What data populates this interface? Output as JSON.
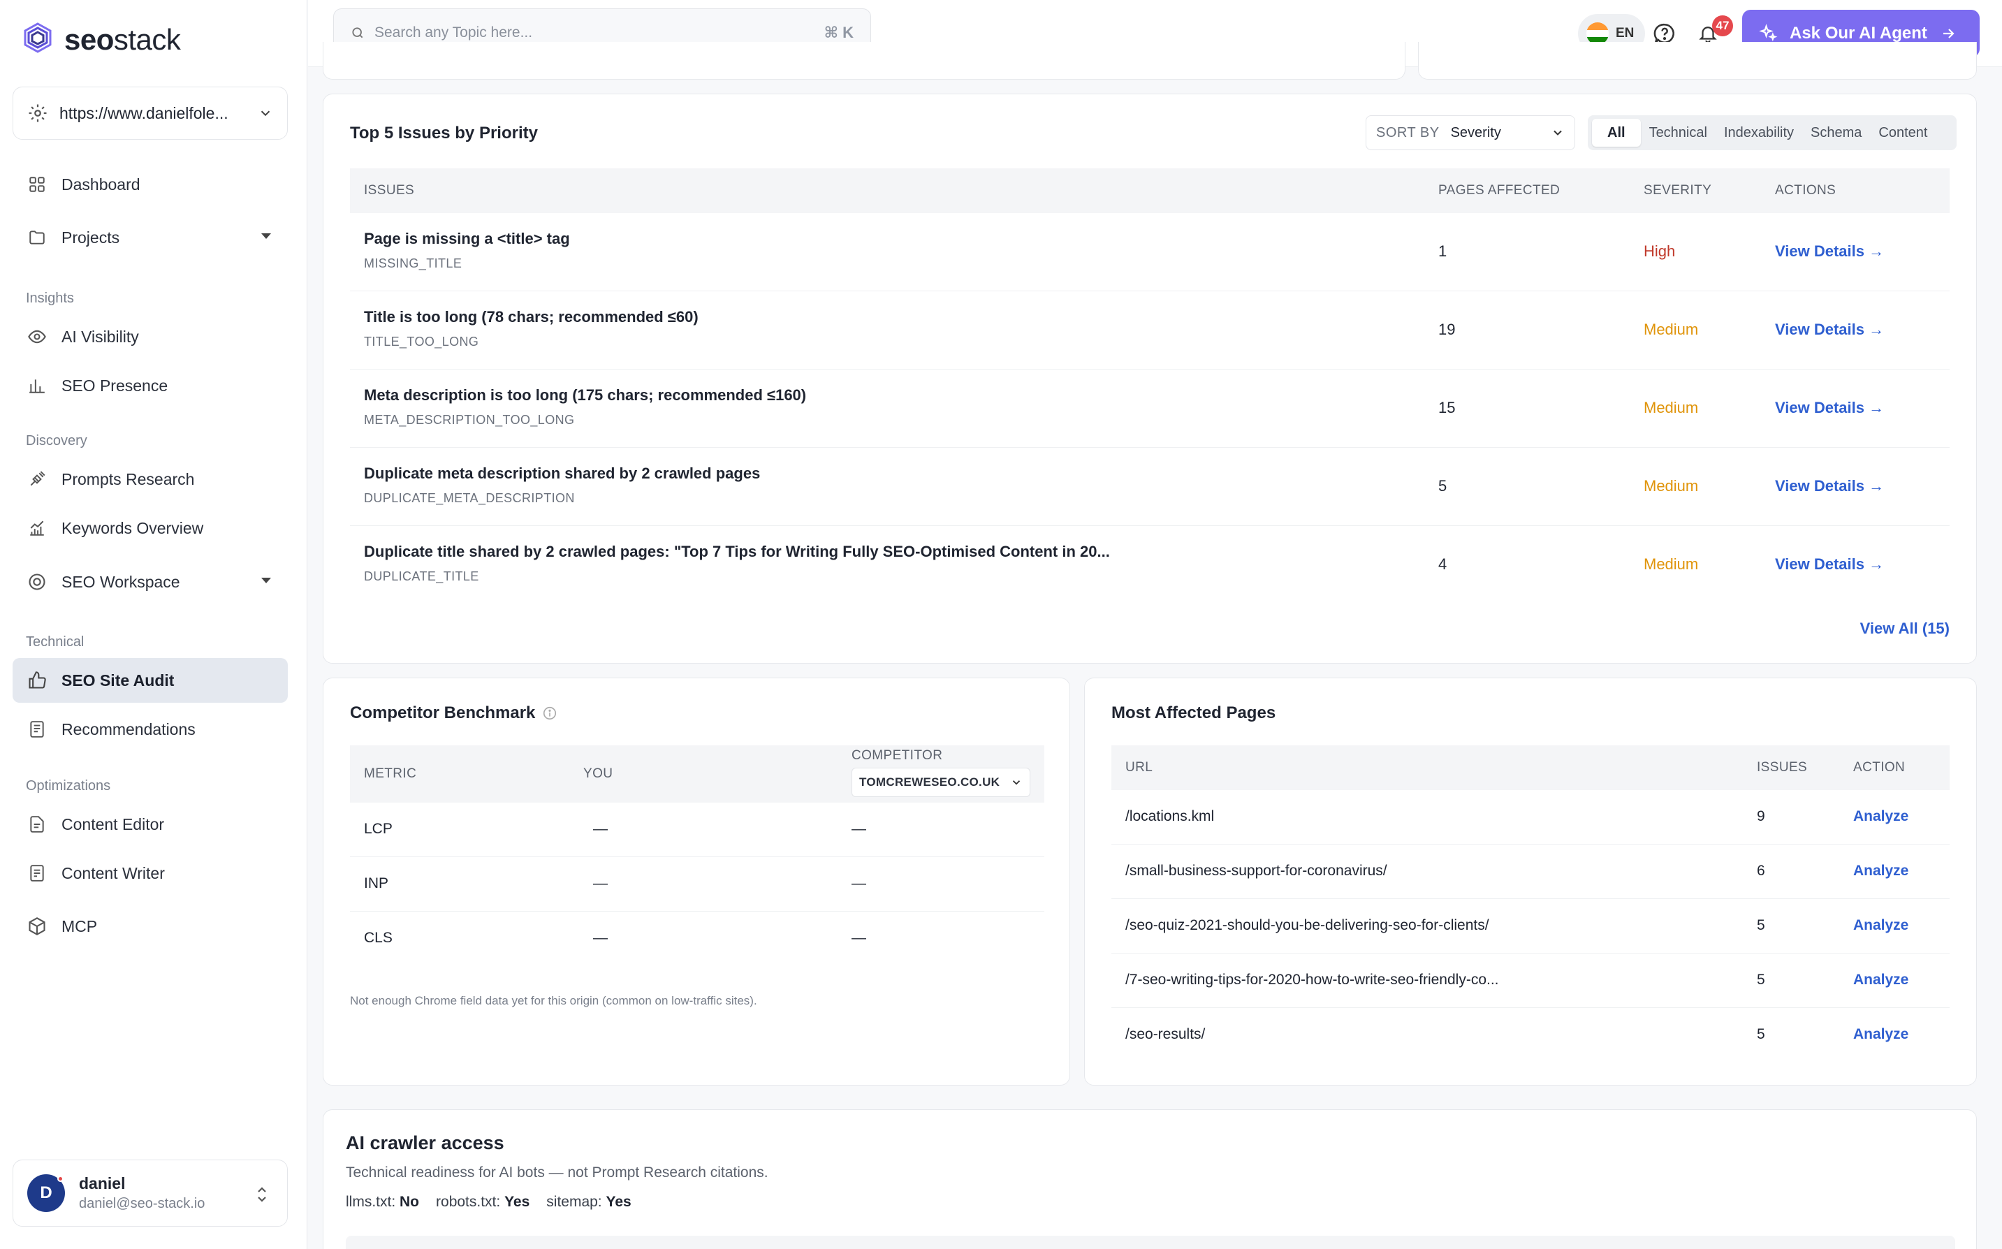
{
  "brand": {
    "name_bold": "seo",
    "name_light": "stack"
  },
  "site_selector": {
    "url": "https://www.danielfole..."
  },
  "sidebar": {
    "items": [
      {
        "label": "Dashboard",
        "icon": "grid-icon"
      },
      {
        "label": "Projects",
        "icon": "folder-icon"
      },
      {
        "label": "AI Visibility",
        "icon": "eye-icon"
      },
      {
        "label": "SEO Presence",
        "icon": "bar-chart-icon"
      },
      {
        "label": "Prompts Research",
        "icon": "satellite-icon"
      },
      {
        "label": "Keywords Overview",
        "icon": "trend-chart-icon"
      },
      {
        "label": "SEO Workspace",
        "icon": "target-icon"
      },
      {
        "label": "SEO Site Audit",
        "icon": "thumbs-up-icon"
      },
      {
        "label": "Recommendations",
        "icon": "document-list-icon"
      },
      {
        "label": "Content Editor",
        "icon": "edit-document-icon"
      },
      {
        "label": "Content Writer",
        "icon": "write-document-icon"
      },
      {
        "label": "MCP",
        "icon": "cube-icon"
      }
    ],
    "sections": {
      "insights": "Insights",
      "discovery": "Discovery",
      "technical": "Technical",
      "optimizations": "Optimizations"
    }
  },
  "user": {
    "initial": "D",
    "name": "daniel",
    "email": "daniel@seo-stack.io"
  },
  "topbar": {
    "search_placeholder": "Search any Topic here...",
    "shortcut": "⌘ K",
    "language": "EN",
    "notification_count": "47",
    "ai_button": "Ask Our AI Agent"
  },
  "issues": {
    "title": "Top 5 Issues by Priority",
    "sort_label": "SORT BY",
    "sort_value": "Severity",
    "filters": [
      "All",
      "Technical",
      "Indexability",
      "Schema",
      "Content"
    ],
    "columns": {
      "issues": "ISSUES",
      "pages": "PAGES AFFECTED",
      "severity": "SEVERITY",
      "actions": "ACTIONS"
    },
    "rows": [
      {
        "title": "Page is missing a <title> tag",
        "code": "MISSING_TITLE",
        "pages": "1",
        "severity": "High",
        "action": "View Details →"
      },
      {
        "title": "Title is too long (78 chars; recommended ≤60)",
        "code": "TITLE_TOO_LONG",
        "pages": "19",
        "severity": "Medium",
        "action": "View Details →"
      },
      {
        "title": "Meta description is too long (175 chars; recommended ≤160)",
        "code": "META_DESCRIPTION_TOO_LONG",
        "pages": "15",
        "severity": "Medium",
        "action": "View Details →"
      },
      {
        "title": "Duplicate meta description shared by 2 crawled pages",
        "code": "DUPLICATE_META_DESCRIPTION",
        "pages": "5",
        "severity": "Medium",
        "action": "View Details →"
      },
      {
        "title": "Duplicate title shared by 2 crawled pages: \"Top 7 Tips for Writing Fully SEO-Optimised Content in 20...",
        "code": "DUPLICATE_TITLE",
        "pages": "4",
        "severity": "Medium",
        "action": "View Details →"
      }
    ],
    "view_all": "View All (15)"
  },
  "benchmark": {
    "title": "Competitor Benchmark",
    "columns": {
      "metric": "METRIC",
      "you": "YOU",
      "competitor": "COMPETITOR"
    },
    "competitor_select": "TOMCREWESEO.CO.UK",
    "rows": [
      {
        "metric": "LCP",
        "you": "—",
        "competitor": "—"
      },
      {
        "metric": "INP",
        "you": "—",
        "competitor": "—"
      },
      {
        "metric": "CLS",
        "you": "—",
        "competitor": "—"
      }
    ],
    "note": "Not enough Chrome field data yet for this origin (common on low-traffic sites)."
  },
  "affected": {
    "title": "Most Affected Pages",
    "columns": {
      "url": "URL",
      "issues": "ISSUES",
      "action": "ACTION"
    },
    "rows": [
      {
        "url": "/locations.kml",
        "issues": "9",
        "action": "Analyze"
      },
      {
        "url": "/small-business-support-for-coronavirus/",
        "issues": "6",
        "action": "Analyze"
      },
      {
        "url": "/seo-quiz-2021-should-you-be-delivering-seo-for-clients/",
        "issues": "5",
        "action": "Analyze"
      },
      {
        "url": "/7-seo-writing-tips-for-2020-how-to-write-seo-friendly-co...",
        "issues": "5",
        "action": "Analyze"
      },
      {
        "url": "/seo-results/",
        "issues": "5",
        "action": "Analyze"
      }
    ]
  },
  "crawler": {
    "title": "AI crawler access",
    "subtitle": "Technical readiness for AI bots — not Prompt Research citations.",
    "llms_label": "llms.txt:",
    "llms_value": "No",
    "robots_label": "robots.txt:",
    "robots_value": "Yes",
    "sitemap_label": "sitemap:",
    "sitemap_value": "Yes"
  },
  "colors": {
    "accent": "#7c6cf0",
    "link": "#2f5fd0",
    "high": "#c0392b",
    "medium": "#e0940a"
  }
}
